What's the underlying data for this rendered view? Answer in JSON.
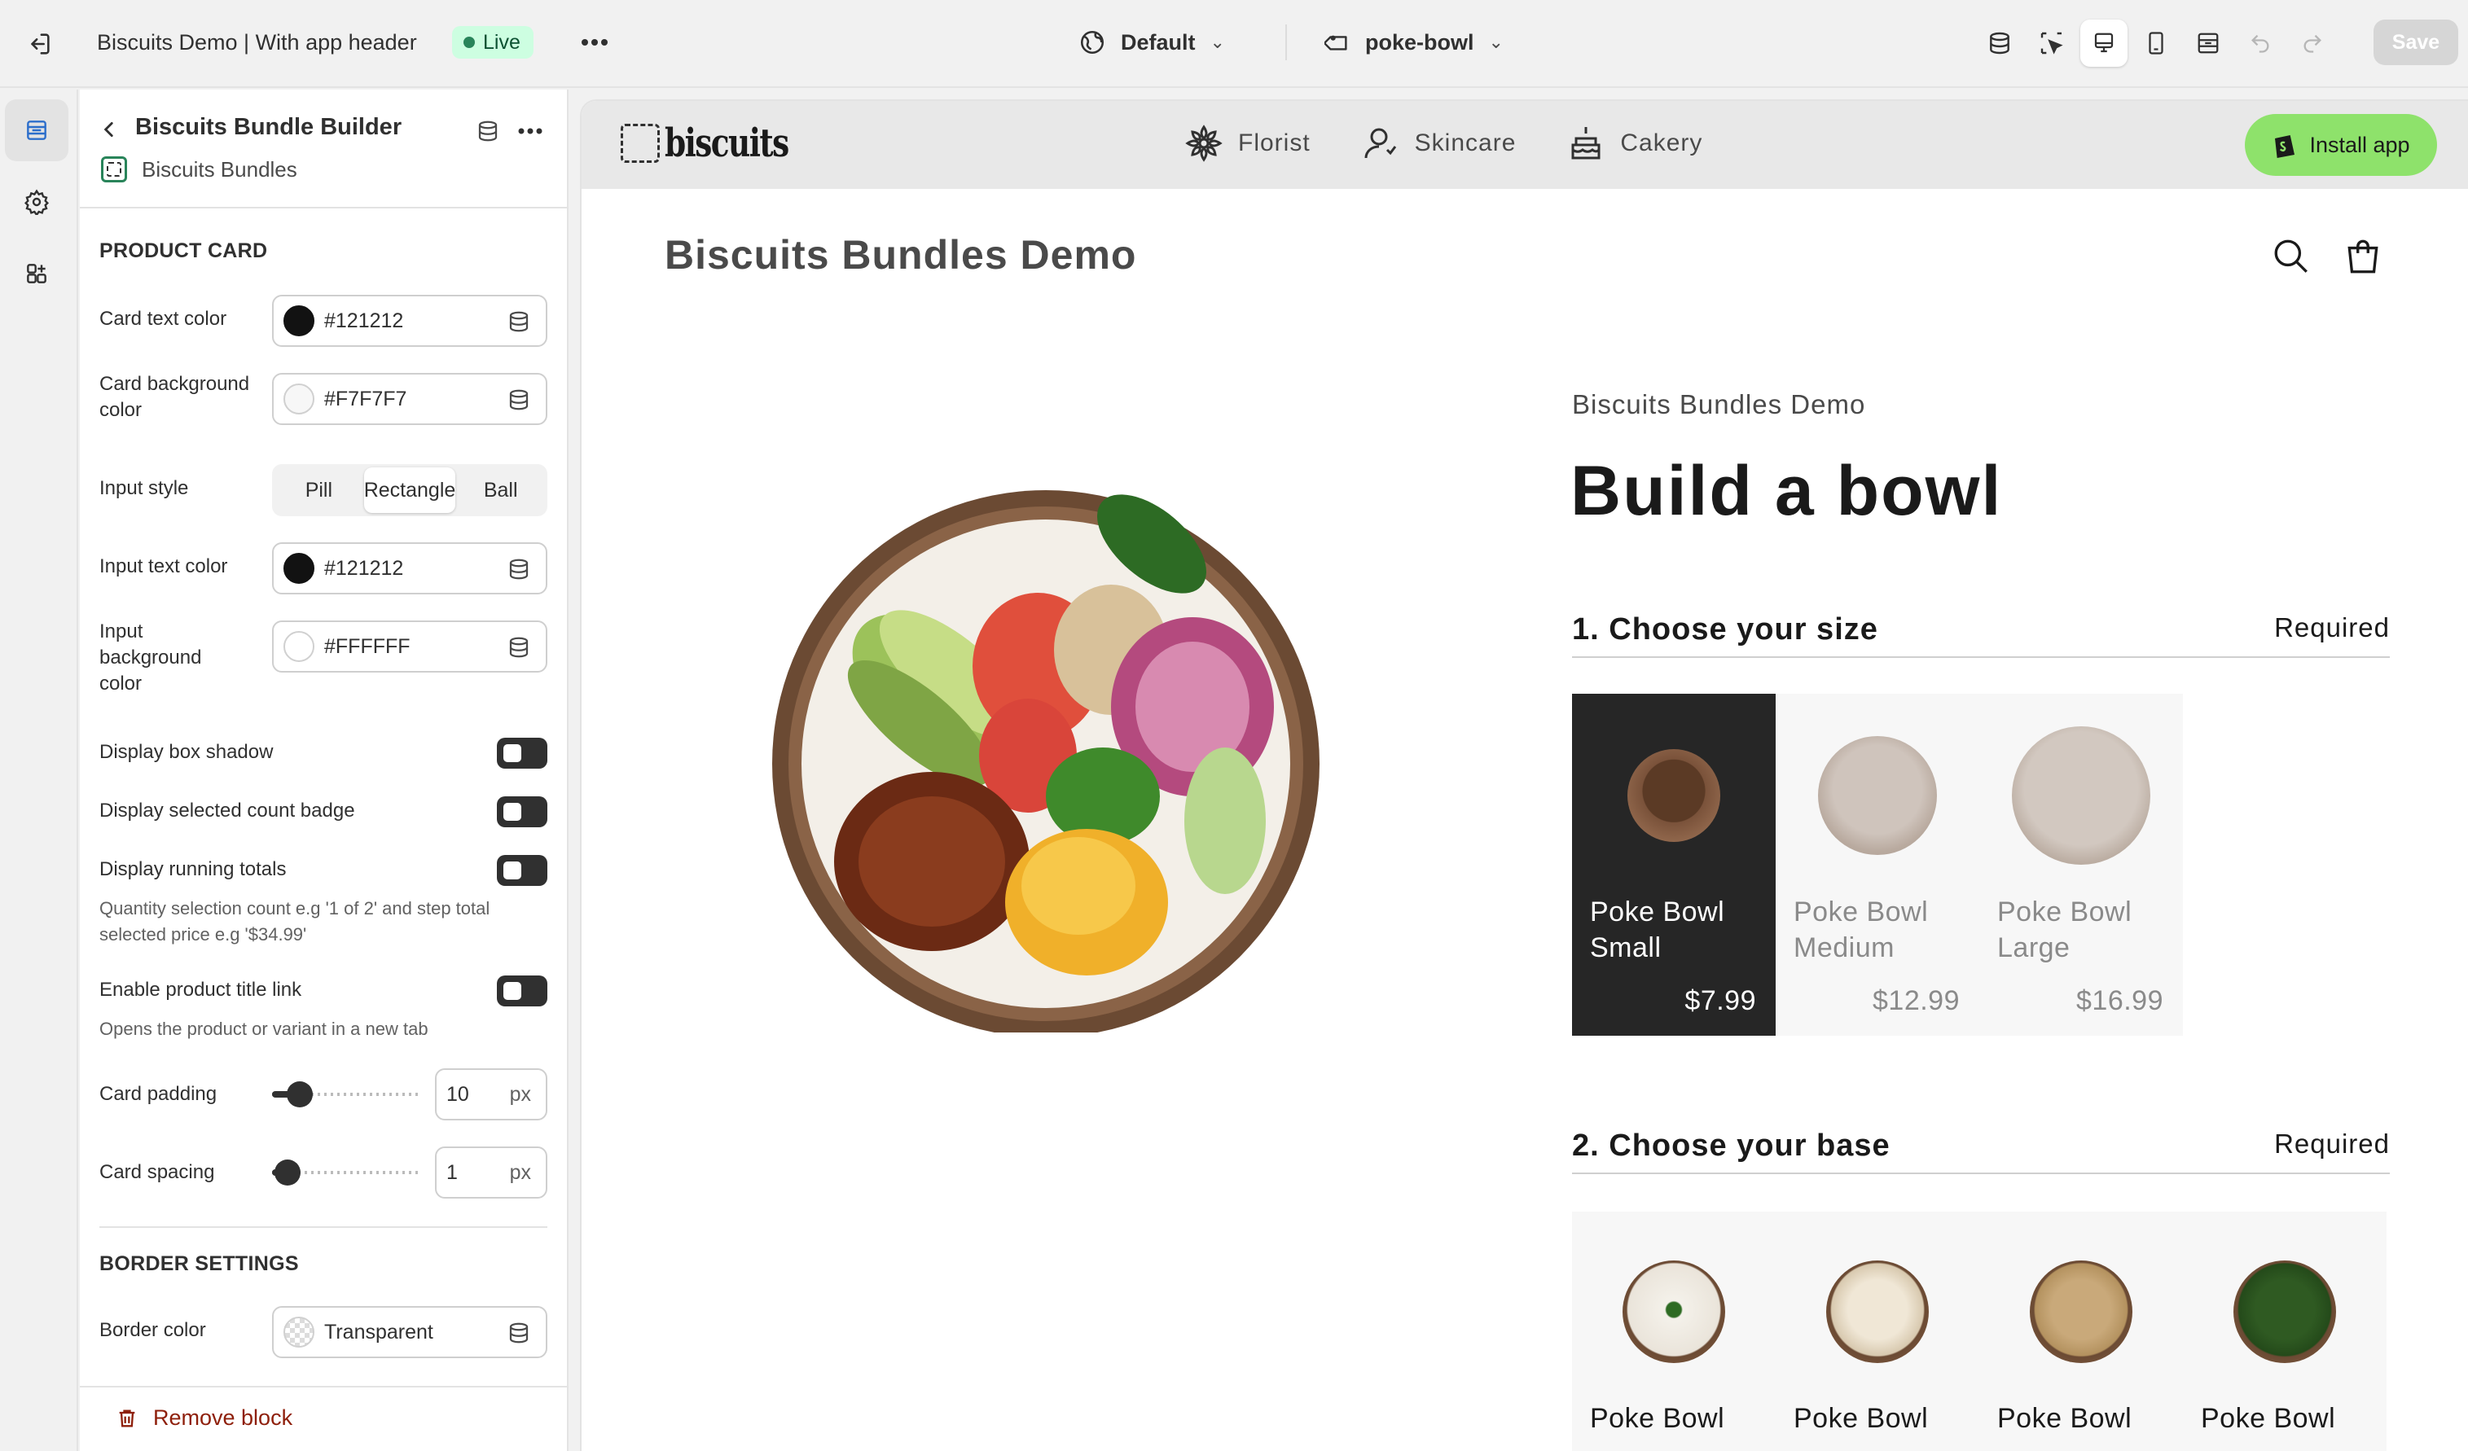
{
  "topbar": {
    "app_title": "Biscuits Demo | With app header",
    "live_label": "Live",
    "theme_label": "Default",
    "template_label": "poke-bowl",
    "save_label": "Save"
  },
  "panel": {
    "block_title": "Biscuits Bundle Builder",
    "app_name": "Biscuits Bundles",
    "product_card_title": "PRODUCT CARD",
    "card_text_color_label": "Card text color",
    "card_text_color_value": "#121212",
    "card_bg_color_label": "Card background color",
    "card_bg_color_value": "#F7F7F7",
    "input_style_label": "Input style",
    "input_style_options": [
      "Pill",
      "Rectangle",
      "Ball"
    ],
    "input_style_selected": "Rectangle",
    "input_text_color_label": "Input text color",
    "input_text_color_value": "#121212",
    "input_bg_color_label": "Input background color",
    "input_bg_color_value": "#FFFFFF",
    "box_shadow_label": "Display box shadow",
    "count_badge_label": "Display selected count badge",
    "running_totals_label": "Display running totals",
    "running_totals_help": "Quantity selection count e.g '1 of 2' and step total selected price e.g '$34.99'",
    "title_link_label": "Enable product title link",
    "title_link_help": "Opens the product or variant in a new tab",
    "card_padding_label": "Card padding",
    "card_padding_value": "10",
    "card_padding_level": 0.12,
    "card_spacing_label": "Card spacing",
    "card_spacing_value": "1",
    "card_spacing_level": 0.02,
    "unit": "px",
    "border_settings_title": "BORDER SETTINGS",
    "border_color_label": "Border color",
    "border_color_value": "Transparent",
    "remove_label": "Remove block"
  },
  "preview": {
    "logo_text": "biscuits",
    "categories": [
      "Florist",
      "Skincare",
      "Cakery"
    ],
    "install_label": "Install app",
    "store_name": "Biscuits Bundles Demo",
    "product_subtitle": "Biscuits Bundles Demo",
    "product_title": "Build a bowl",
    "step1_title": "1.  Choose your size",
    "step1_req": "Required",
    "step1_cards": [
      {
        "name": "Poke Bowl",
        "variant": "Small",
        "price": "$7.99"
      },
      {
        "name": "Poke Bowl",
        "variant": "Medium",
        "price": "$12.99"
      },
      {
        "name": "Poke Bowl",
        "variant": "Large",
        "price": "$16.99"
      }
    ],
    "step2_title": "2.  Choose your base",
    "step2_req": "Required",
    "step2_cards": [
      {
        "name": "Poke Bowl"
      },
      {
        "name": "Poke Bowl"
      },
      {
        "name": "Poke Bowl"
      },
      {
        "name": "Poke Bowl"
      }
    ]
  },
  "colors": {
    "accent_live": "#cdfee1",
    "install_green": "#8ee26b",
    "selected_card": "#262626",
    "remove_red": "#8e1f0b"
  }
}
